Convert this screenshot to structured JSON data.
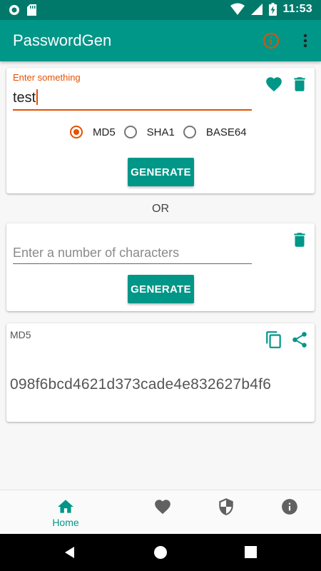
{
  "status_bar": {
    "time": "11:53"
  },
  "app_bar": {
    "title": "PasswordGen"
  },
  "hash_card": {
    "input_label": "Enter something",
    "input_value": "test",
    "radio_options": [
      "MD5",
      "SHA1",
      "BASE64"
    ],
    "selected_option": "MD5",
    "generate_label": "GENERATE"
  },
  "divider_text": "OR",
  "random_card": {
    "input_placeholder": "Enter a number of characters",
    "generate_label": "GENERATE"
  },
  "result_card": {
    "algorithm": "MD5",
    "value": "098f6bcd4621d373cade4e832627b4f6"
  },
  "bottom_nav": {
    "home_label": "Home"
  },
  "colors": {
    "primary": "#009688",
    "primary_dark": "#00796b",
    "accent": "#e65100",
    "icon_gray": "#616161"
  }
}
